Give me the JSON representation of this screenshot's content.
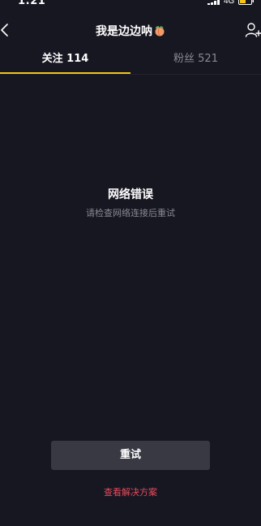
{
  "status_bar": {
    "time": "1:21",
    "network": "4G",
    "icons": [
      "signal-icon",
      "battery-icon"
    ]
  },
  "nav": {
    "back_icon": "chevron-left-icon",
    "title": "我是边边呐",
    "title_emoji_icon": "peach-icon",
    "action_icon": "add-user-icon"
  },
  "tabs": [
    {
      "label": "关注 114",
      "active": true
    },
    {
      "label": "粉丝 521",
      "active": false
    }
  ],
  "error": {
    "title": "网络错误",
    "message": "请检查网络连接后重试"
  },
  "actions": {
    "retry_label": "重试",
    "solutions_label": "查看解决方案"
  },
  "colors": {
    "background": "#171722",
    "tab_indicator": "#f5c518",
    "button_bg": "#393943",
    "link": "#e64a5c",
    "muted_text": "#8a8a94"
  }
}
